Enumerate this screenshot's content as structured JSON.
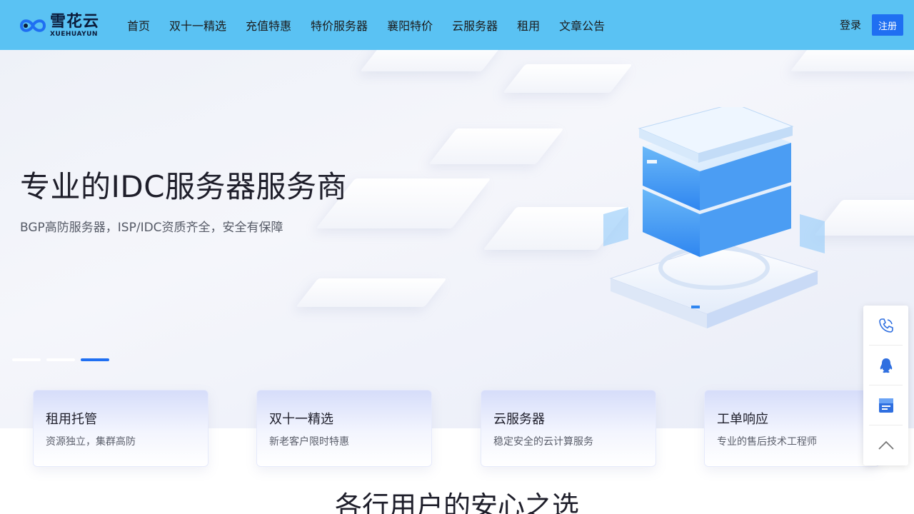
{
  "brand": {
    "name_cn": "雪花云",
    "name_en": "XUEHUAYUN"
  },
  "nav": {
    "items": [
      {
        "label": "首页"
      },
      {
        "label": "双十一精选"
      },
      {
        "label": "充值特惠"
      },
      {
        "label": "特价服务器"
      },
      {
        "label": "襄阳特价"
      },
      {
        "label": "云服务器"
      },
      {
        "label": "租用"
      },
      {
        "label": "文章公告"
      }
    ],
    "login_label": "登录",
    "register_label": "注册"
  },
  "hero": {
    "title": "专业的IDC服务器服务商",
    "subtitle": "BGP高防服务器，ISP/IDC资质齐全，安全有保障",
    "slides": 3,
    "active_slide": 3
  },
  "cards": [
    {
      "title": "租用托管",
      "desc": "资源独立，集群高防"
    },
    {
      "title": "双十一精选",
      "desc": "新老客户限时特惠"
    },
    {
      "title": "云服务器",
      "desc": "稳定安全的云计算服务"
    },
    {
      "title": "工单响应",
      "desc": "专业的售后技术工程师"
    }
  ],
  "section": {
    "title": "各行用户的安心之选"
  },
  "sidebar": {
    "items": [
      {
        "icon": "phone-icon"
      },
      {
        "icon": "qq-icon"
      },
      {
        "icon": "ticket-icon"
      },
      {
        "icon": "chevron-up-icon"
      }
    ]
  },
  "colors": {
    "header_bg": "#5ac2f3",
    "accent": "#1f6ff2"
  }
}
